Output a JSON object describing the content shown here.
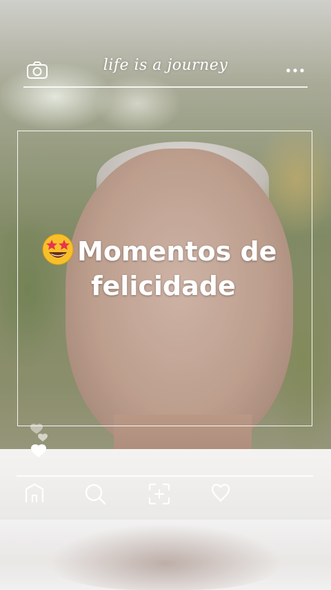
{
  "story": {
    "slogan": "life is a journey",
    "title_line1": "Momentos de",
    "title_line2": "felicidade"
  },
  "icons": {
    "top_left": "camera-icon",
    "top_right": "more-dots-icon",
    "emoji": "star-struck-emoji-icon",
    "hearts": "hearts-icon",
    "nav": [
      "home-icon",
      "search-icon",
      "add-post-icon",
      "heart-icon"
    ]
  },
  "colors": {
    "overlay_line": "#ffffff",
    "text": "#ffffff",
    "emoji_face": "#f7c02a",
    "emoji_star": "#e8344e"
  }
}
